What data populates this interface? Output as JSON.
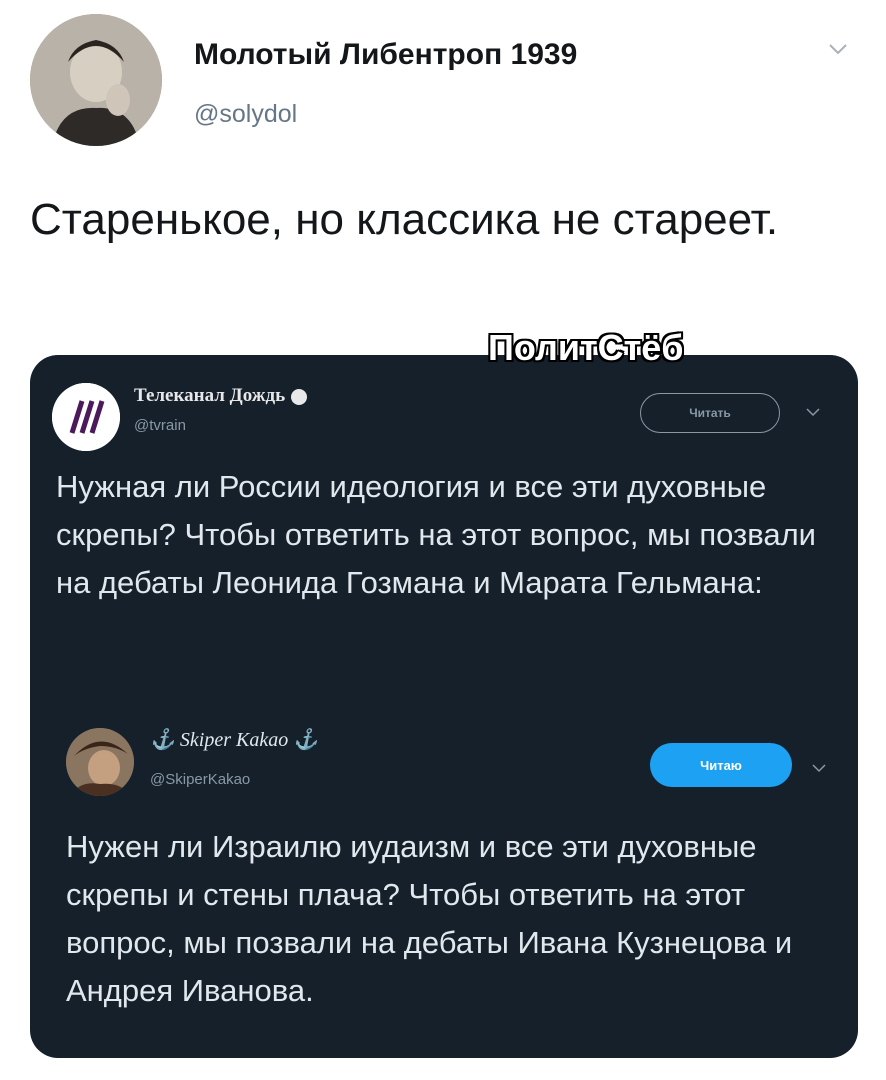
{
  "author": {
    "name": "Молотый Либентроп 1939",
    "handle": "@solydol",
    "avatar_icon": "user-avatar-photo"
  },
  "tweet": {
    "text": "Старенькое, но классика не стареет."
  },
  "watermark": "ПолитСтёб",
  "embedded": {
    "tweet1": {
      "name": "Телеканал Дождь",
      "handle": "@tvrain",
      "button": "Читать",
      "text": "Нужная ли России идеология и все эти духовные скрепы? Чтобы ответить на этот вопрос, мы позвали на дебаты Леонида Гозмана и Марата Гельмана:"
    },
    "tweet2": {
      "name": "⚓ Skiper Kakao ⚓",
      "handle": "@SkiperKakao",
      "button": "Читаю",
      "text": "Нужен ли Израилю иудаизм и все эти духовные скрепы и стены плача? Чтобы ответить на этот вопрос, мы позвали на дебаты Ивана Кузнецова и Андрея Иванова."
    }
  },
  "colors": {
    "card_bg": "#15202b",
    "accent": "#1da1f2"
  }
}
